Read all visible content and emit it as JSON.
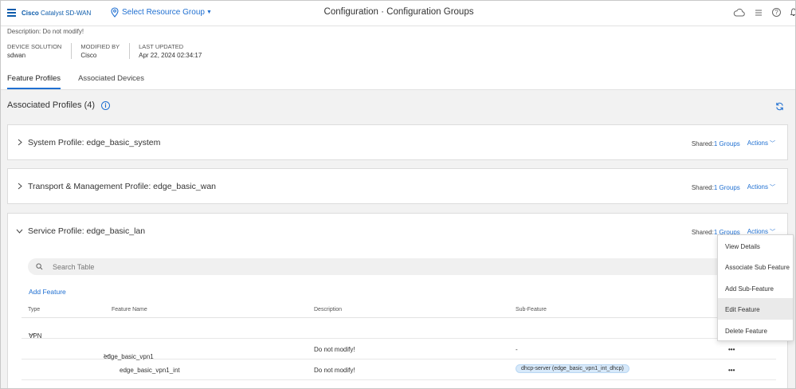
{
  "app": {
    "brand_bold": "Cisco",
    "brand_rest": "Catalyst SD-WAN",
    "resource_label": "Select Resource Group",
    "page_title": "Configuration · Configuration Groups"
  },
  "meta": {
    "description": "Description: Do not modify!",
    "columns": [
      {
        "label": "DEVICE SOLUTION",
        "value": "sdwan"
      },
      {
        "label": "MODIFIED BY",
        "value": "Cisco"
      },
      {
        "label": "LAST UPDATED",
        "value": "Apr 22, 2024 02:34:17"
      }
    ]
  },
  "tabs": [
    {
      "label": "Feature Profiles",
      "active": true
    },
    {
      "label": "Associated Devices",
      "active": false
    }
  ],
  "associated": {
    "title": "Associated Profiles (4)",
    "info_icon": "i"
  },
  "profiles": [
    {
      "name": "System Profile: edge_basic_system",
      "shared_label": "Shared:",
      "shared_link": "1 Groups",
      "actions_label": "Actions"
    },
    {
      "name": "Transport & Management Profile: edge_basic_wan",
      "shared_label": "Shared:",
      "shared_link": "1 Groups",
      "actions_label": "Actions"
    },
    {
      "name": "Service Profile: edge_basic_lan",
      "shared_label": "Shared:",
      "shared_link": "1 Groups",
      "actions_label": "Actions"
    }
  ],
  "service_table": {
    "search_placeholder": "Search Table",
    "add_feature_label": "Add Feature",
    "columns": [
      "Type",
      "Feature Name",
      "Description",
      "Sub-Feature"
    ],
    "rows": [
      {
        "type": "VPN",
        "feature": "",
        "description": "",
        "sub": ""
      },
      {
        "type": "",
        "feature": "edge_basic_vpn1",
        "description": "Do not modify!",
        "sub": "-",
        "kebab": "•••"
      },
      {
        "type": "",
        "feature": "edge_basic_vpn1_int",
        "description": "Do not modify!",
        "sub": "dhcp-server (edge_basic_vpn1_int_dhcp)",
        "kebab": "•••"
      }
    ]
  },
  "actions_menu": {
    "items": [
      "View Details",
      "Associate Sub Feature",
      "Add Sub-Feature",
      "Edit Feature",
      "Delete Feature"
    ],
    "hovered": "Edit Feature"
  },
  "colors": {
    "accent": "#1f6fd1",
    "brand": "#0d5cab",
    "content_bg": "#f2f2f2",
    "pill_bg": "#d7e9fa"
  },
  "icons": [
    "hamburger-icon",
    "location-pin-icon",
    "cloud-icon",
    "list-icon",
    "help-icon",
    "bell-icon",
    "info-icon",
    "refresh-icon",
    "chevron-right-icon",
    "chevron-down-icon",
    "search-icon",
    "more-icon"
  ]
}
